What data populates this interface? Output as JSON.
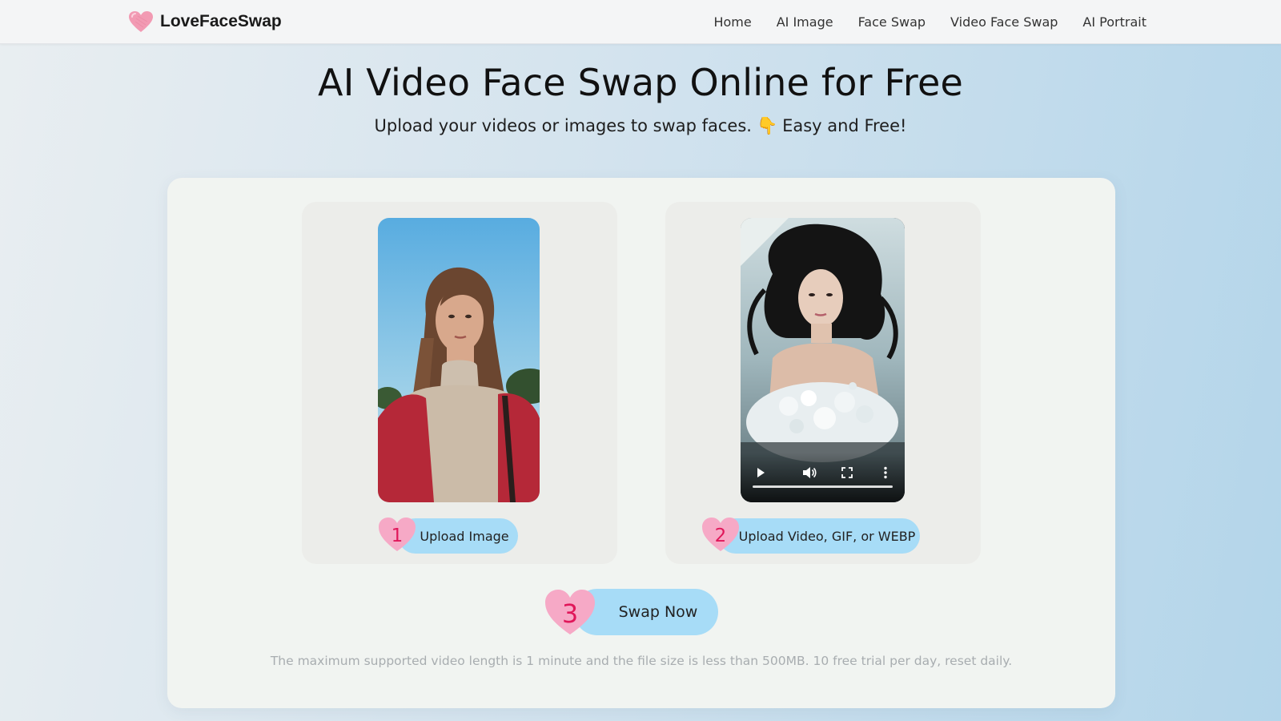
{
  "header": {
    "brand": "LoveFaceSwap",
    "logo_icon": "heart-logo-icon",
    "nav": [
      {
        "label": "Home"
      },
      {
        "label": "AI Image"
      },
      {
        "label": "Face Swap"
      },
      {
        "label": "Video Face Swap"
      },
      {
        "label": "AI Portrait"
      }
    ]
  },
  "hero": {
    "title": "AI Video Face Swap Online for Free",
    "subtitle_before": "Upload your videos or images to swap faces.",
    "subtitle_emoji": "👇",
    "subtitle_after": "Easy and Free!"
  },
  "steps": {
    "image": {
      "number": "1",
      "label": "Upload Image"
    },
    "video": {
      "number": "2",
      "label": "Upload Video, GIF, or WEBP"
    },
    "swap": {
      "number": "3",
      "label": "Swap Now"
    }
  },
  "video_controls": {
    "play_icon": "play-icon",
    "volume_icon": "volume-icon",
    "fullscreen_icon": "fullscreen-icon",
    "more_icon": "more-options-icon"
  },
  "note": "The maximum supported video length is 1 minute and the file size is less than 500MB. 10 free trial per day, reset daily.",
  "colors": {
    "button_bg": "#a7dcf7",
    "heart_pink": "#f6a9c6",
    "heart_number": "#e0175a",
    "card_bg": "#f1f4f1",
    "panel_bg": "#ecedea"
  }
}
